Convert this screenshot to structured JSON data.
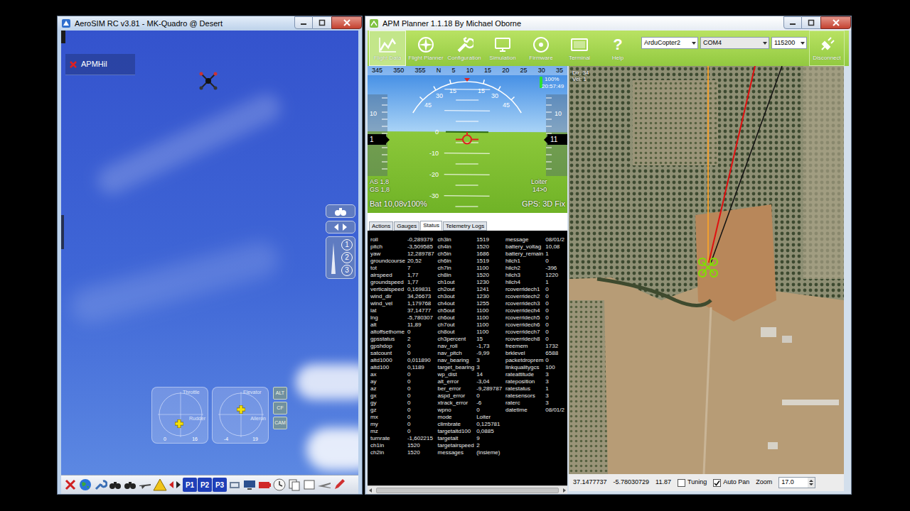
{
  "sim": {
    "title": "AeroSIM RC v3.81 - MK-Quadro @ Desert",
    "overlay_label": "APMHil",
    "camera_numbers": [
      "1",
      "2",
      "3"
    ],
    "sticks": [
      {
        "top_label": "Throttle",
        "side_label": "Rudder",
        "left_value": "0",
        "right_value": "16",
        "level_x": 0.47,
        "level_y": 0.72
      },
      {
        "top_label": "Elevator",
        "side_label": "Aileron",
        "left_value": "-4",
        "right_value": "19",
        "level_x": 0.5,
        "level_y": 0.38
      }
    ],
    "mode_buttons": [
      "ALT",
      "CF",
      "CAM"
    ],
    "presets": [
      "P1",
      "P2",
      "P3"
    ]
  },
  "planner": {
    "title": "APM Planner 1.1.18 By Michael Oborne",
    "nav": [
      {
        "label": "Flight Data",
        "selected": true
      },
      {
        "label": "Flight Planner",
        "selected": false
      },
      {
        "label": "Configuration",
        "selected": false
      },
      {
        "label": "Simulation",
        "selected": false
      },
      {
        "label": "Firmware",
        "selected": false
      },
      {
        "label": "Terminal",
        "selected": false
      },
      {
        "label": "Help",
        "selected": false,
        "glyph": "?"
      }
    ],
    "vehicle": "ArduCopter2",
    "port": "COM4",
    "baud": "115200",
    "connect_button": "Disconnect",
    "hud": {
      "pitch": -3.5,
      "roll": -0.29,
      "heading_ticks": [
        "345",
        "350",
        "355",
        "N",
        "5",
        "10",
        "15",
        "20",
        "25",
        "30",
        "35"
      ],
      "roll_labels": [
        "45",
        "30",
        "15",
        "15",
        "30",
        "45"
      ],
      "pitch_ladder": [
        "0",
        "-10",
        "-20",
        "-30"
      ],
      "airspeed_ticks": [
        "10"
      ],
      "airspeed": "1",
      "altitude_ticks": [
        "10"
      ],
      "altitude": "11",
      "link": "100%",
      "link_level": 1,
      "clock": "20:57:49",
      "airspeed_text": "AS 1,8",
      "groundspeed_text": "GS 1,8",
      "battery": "Bat 10,08v100%",
      "mode": "Loiter",
      "waypoint": "14>0",
      "gps": "GPS: 3D Fix"
    },
    "tabs": [
      {
        "label": "Actions",
        "selected": false
      },
      {
        "label": "Gauges",
        "selected": false
      },
      {
        "label": "Status",
        "selected": true
      },
      {
        "label": "Telemetry Logs",
        "selected": false
      }
    ],
    "status": {
      "columns": [
        [
          {
            "name": "roll",
            "value": "-0,289379"
          },
          {
            "name": "pitch",
            "value": "-3,509585"
          },
          {
            "name": "yaw",
            "value": "12,289787"
          },
          {
            "name": "groundcourse",
            "value": "20,52"
          },
          {
            "name": "tot",
            "value": "7"
          },
          {
            "name": "airspeed",
            "value": "1,77"
          },
          {
            "name": "groundspeed",
            "value": "1,77"
          },
          {
            "name": "verticalspeed",
            "value": "0,169831"
          },
          {
            "name": "wind_dir",
            "value": "34,26673"
          },
          {
            "name": "wind_vel",
            "value": "1,179768"
          },
          {
            "name": "lat",
            "value": "37,14777"
          },
          {
            "name": "lng",
            "value": "-5,780307"
          },
          {
            "name": "alt",
            "value": "11,89"
          },
          {
            "name": "altoffsethome",
            "value": "0"
          },
          {
            "name": "gpsstatus",
            "value": "2"
          },
          {
            "name": "gpshdop",
            "value": "0"
          },
          {
            "name": "satcount",
            "value": "0"
          },
          {
            "name": "altd1000",
            "value": "0,011890"
          },
          {
            "name": "altd100",
            "value": "0,1189"
          },
          {
            "name": "ax",
            "value": "0"
          },
          {
            "name": "ay",
            "value": "0"
          },
          {
            "name": "az",
            "value": "0"
          },
          {
            "name": "gx",
            "value": "0"
          },
          {
            "name": "gy",
            "value": "0"
          },
          {
            "name": "gz",
            "value": "0"
          },
          {
            "name": "mx",
            "value": "0"
          },
          {
            "name": "my",
            "value": "0"
          },
          {
            "name": "mz",
            "value": "0"
          },
          {
            "name": "turnrate",
            "value": "-1,602215"
          },
          {
            "name": "ch1in",
            "value": "1520"
          },
          {
            "name": "ch2in",
            "value": "1520"
          }
        ],
        [
          {
            "name": "ch3in",
            "value": "1519"
          },
          {
            "name": "ch4in",
            "value": "1520"
          },
          {
            "name": "ch5in",
            "value": "1686"
          },
          {
            "name": "ch6in",
            "value": "1519"
          },
          {
            "name": "ch7in",
            "value": "1100"
          },
          {
            "name": "ch8in",
            "value": "1520"
          },
          {
            "name": "ch1out",
            "value": "1230"
          },
          {
            "name": "ch2out",
            "value": "1241"
          },
          {
            "name": "ch3out",
            "value": "1230"
          },
          {
            "name": "ch4out",
            "value": "1255"
          },
          {
            "name": "ch5out",
            "value": "1100"
          },
          {
            "name": "ch6out",
            "value": "1100"
          },
          {
            "name": "ch7out",
            "value": "1100"
          },
          {
            "name": "ch8out",
            "value": "1100"
          },
          {
            "name": "ch3percent",
            "value": "15"
          },
          {
            "name": "nav_roll",
            "value": "-1,73"
          },
          {
            "name": "nav_pitch",
            "value": "-9,99"
          },
          {
            "name": "nav_bearing",
            "value": "3"
          },
          {
            "name": "target_bearing",
            "value": "3"
          },
          {
            "name": "wp_dist",
            "value": "14"
          },
          {
            "name": "alt_error",
            "value": "-3,04"
          },
          {
            "name": "ber_error",
            "value": "-9,289787"
          },
          {
            "name": "aspd_error",
            "value": "0"
          },
          {
            "name": "xtrack_error",
            "value": "-6"
          },
          {
            "name": "wpno",
            "value": "0"
          },
          {
            "name": "mode",
            "value": "Loiter"
          },
          {
            "name": "climbrate",
            "value": "0,125781"
          },
          {
            "name": "targetaltd100",
            "value": "0,0885"
          },
          {
            "name": "targetalt",
            "value": "9"
          },
          {
            "name": "targetairspeed",
            "value": "2"
          },
          {
            "name": "messages",
            "value": "(Insieme)"
          }
        ],
        [
          {
            "name": "message",
            "value": "08/01/2"
          },
          {
            "name": "battery_voltag",
            "value": "10,08"
          },
          {
            "name": "battery_remain",
            "value": "1"
          },
          {
            "name": "hilch1",
            "value": "0"
          },
          {
            "name": "hilch2",
            "value": "-396"
          },
          {
            "name": "hilch3",
            "value": "1220"
          },
          {
            "name": "hilch4",
            "value": "1"
          },
          {
            "name": "rcoverridech1",
            "value": "0"
          },
          {
            "name": "rcoverridech2",
            "value": "0"
          },
          {
            "name": "rcoverridech3",
            "value": "0"
          },
          {
            "name": "rcoverridech4",
            "value": "0"
          },
          {
            "name": "rcoverridech5",
            "value": "0"
          },
          {
            "name": "rcoverridech6",
            "value": "0"
          },
          {
            "name": "rcoverridech7",
            "value": "0"
          },
          {
            "name": "rcoverridech8",
            "value": "0"
          },
          {
            "name": "freemem",
            "value": "1732"
          },
          {
            "name": "brklevel",
            "value": "6588"
          },
          {
            "name": "packetdroprem",
            "value": "0"
          },
          {
            "name": "linkqualitygcs",
            "value": "100"
          },
          {
            "name": "rateattitude",
            "value": "3"
          },
          {
            "name": "rateposition",
            "value": "3"
          },
          {
            "name": "ratestatus",
            "value": "1"
          },
          {
            "name": "ratesensors",
            "value": "3"
          },
          {
            "name": "raterc",
            "value": "3"
          },
          {
            "name": "datetime",
            "value": "08/01/2"
          }
        ]
      ]
    },
    "map": {
      "dir": "Dir: 34",
      "vel": "Vel: 1",
      "lat": "37.1477737",
      "lng": "-5.78030729",
      "alt": "11.87",
      "tuning": {
        "label": "Tuning",
        "checked": false
      },
      "auto_pan": {
        "label": "Auto Pan",
        "checked": true
      },
      "zoom_label": "Zoom",
      "zoom": "17.0"
    }
  }
}
